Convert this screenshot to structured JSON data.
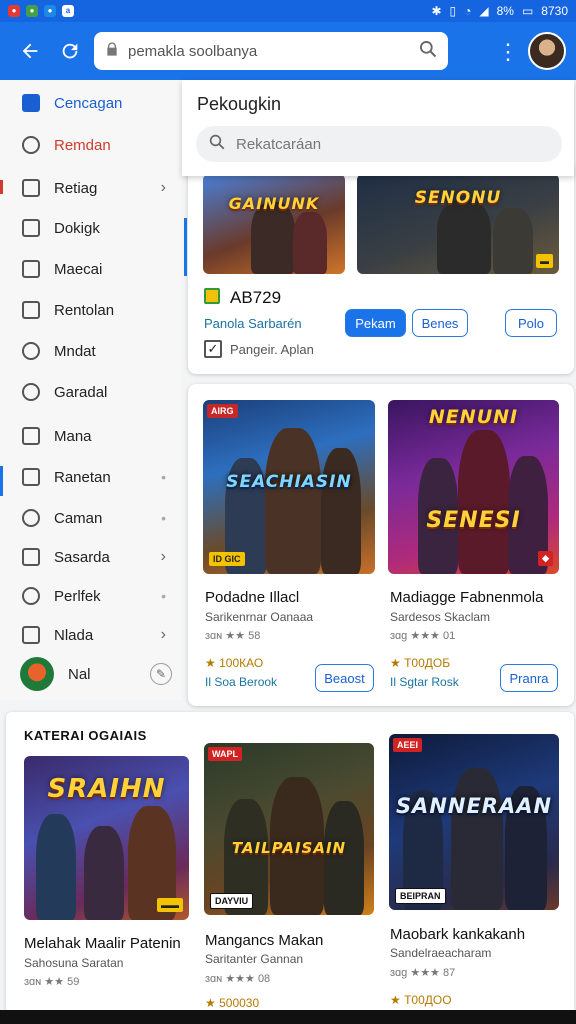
{
  "status_bar": {
    "battery": "8%",
    "time": "8730"
  },
  "app_bar": {
    "address": "pemakla soolbanya",
    "icons": [
      "back-arrow-icon",
      "refresh-icon",
      "lock-icon",
      "search-icon",
      "more-vert-icon"
    ]
  },
  "sidebar": {
    "items": [
      {
        "label": "Cencagan",
        "icon": "home-icon",
        "accessory": ""
      },
      {
        "label": "Remdan",
        "icon": "user-icon",
        "accessory": ""
      },
      {
        "label": "Retiag",
        "icon": "chart-icon",
        "accessory": "chevron"
      },
      {
        "label": "Dokigk",
        "icon": "check-icon",
        "accessory": ""
      },
      {
        "label": "Maecai",
        "icon": "image-icon",
        "accessory": ""
      },
      {
        "label": "Rentolan",
        "icon": "doc-icon",
        "accessory": ""
      },
      {
        "label": "Mndat",
        "icon": "people-icon",
        "accessory": ""
      },
      {
        "label": "Garadal",
        "icon": "settings-icon",
        "accessory": ""
      },
      {
        "label": "Mana",
        "icon": "grid-icon",
        "accessory": ""
      },
      {
        "label": "Ranetan",
        "icon": "calendar-icon",
        "accessory": "dot"
      },
      {
        "label": "Caman",
        "icon": "phone-icon",
        "accessory": "dot"
      },
      {
        "label": "Sasarda",
        "icon": "folder-icon",
        "accessory": "chevron"
      },
      {
        "label": "Perlfek",
        "icon": "call-icon",
        "accessory": "dot"
      },
      {
        "label": "Nlada",
        "icon": "box-icon",
        "accessory": "chevron"
      }
    ],
    "profile_label": "Nal"
  },
  "search_popup": {
    "title": "Pekougkin",
    "placeholder": "Rekatcaráan"
  },
  "top_card": {
    "thumb1_caption": "GAINUNK",
    "thumb2_caption": "SENONU",
    "app_id": "AB729",
    "subtitle": "Panola Sarbarén",
    "buttons": [
      "Pekam",
      "Benes",
      "Polo"
    ],
    "checkbox_label": "Pangeir. Aplan"
  },
  "featured_card": {
    "items": [
      {
        "caption": "SEACHIASIN",
        "badge_top": "AIRG",
        "badge_bottom": "ID GIC",
        "name": "Podadne Illacl",
        "sub": "Sarikenrnar Oanaaa",
        "rating_text": "ɜɑɴ ★★ 58",
        "count": "100КАО",
        "link": "Il Soa Berook",
        "button": "Beaost"
      },
      {
        "caption": "SENESI",
        "banner": "NENUNI",
        "badge_top": "",
        "badge_bottom": "",
        "name": "Madiagge Fabnenmola",
        "sub": "Sardesos Skaclam",
        "rating_text": "ɜɑɡ ★★★ 01",
        "count": "Т00ДОБ",
        "link": "Il Sgtar Rosk",
        "button": "Pranra"
      }
    ]
  },
  "section": {
    "title": "KATERAI OGAIAIS",
    "items": [
      {
        "caption": "SRAIHN",
        "badge": "",
        "name": "Melahak Maalir Patenin",
        "sub": "Sahosuna Saratan",
        "rating_text": "ɜɑɴ ★★ 59",
        "count": ""
      },
      {
        "caption": "TAILPAISAIN",
        "badge": "WAPL",
        "badge_bottom": "DAYVIU",
        "name": "Mangancs Makan",
        "sub": "Saritanter Gannan",
        "rating_text": "ɜɑɴ ★★★ 08",
        "count": "500030"
      },
      {
        "caption": "SANNERAAN",
        "badge": "AEEI",
        "badge_bottom": "BEIPRAN",
        "name": "Maobark kankakanh",
        "sub": "Sandelraeacharam",
        "rating_text": "ɜɑɡ ★★★ 87",
        "count": "Т00ДОО"
      }
    ]
  }
}
